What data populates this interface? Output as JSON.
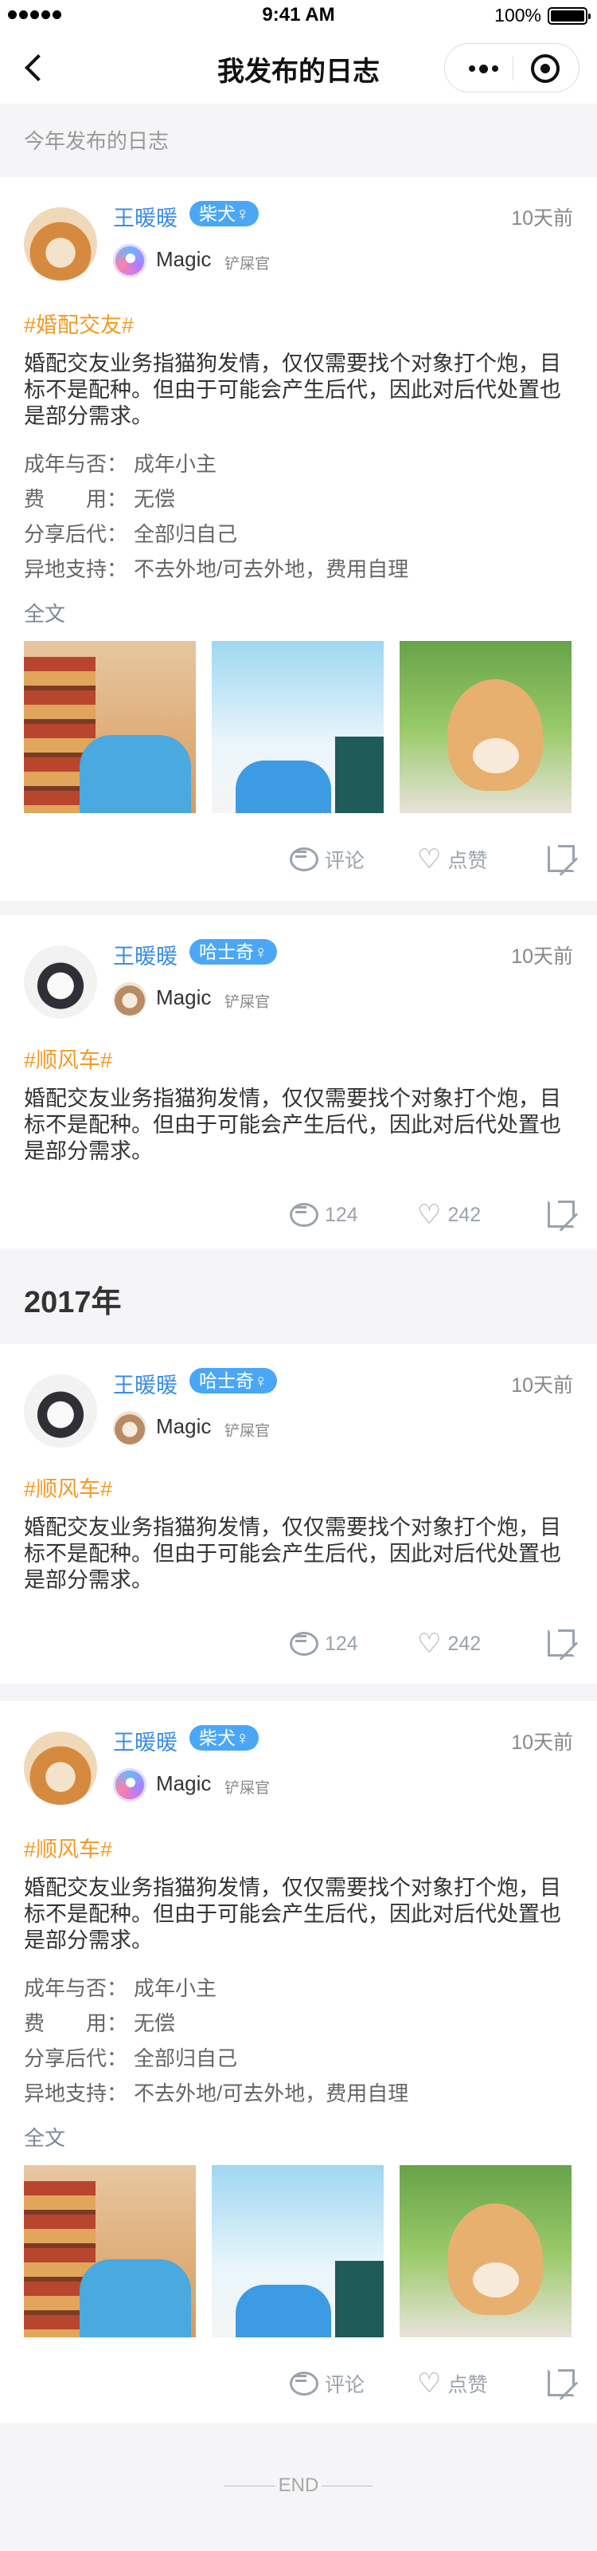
{
  "status_bar": {
    "time": "9:41 AM",
    "battery": "100%"
  },
  "nav": {
    "title": "我发布的日志"
  },
  "sections": {
    "this_year": "今年发布的日志",
    "year_2017": "2017年"
  },
  "posts": [
    {
      "user": "王暖暖",
      "breed": "柴犬♀",
      "time": "10天前",
      "pet_name": "Magic",
      "pet_role": "铲屎官",
      "tag": "#婚配交友#",
      "body": "婚配交友业务指猫狗发情，仅仅需要找个对象打个炮，目标不是配种。但由于可能会产生后代，因此对后代处置也是部分需求。",
      "info": [
        {
          "key": "成年与否：",
          "value": "成年小主"
        },
        {
          "key": "费　　用：",
          "value": "无偿"
        },
        {
          "key": "分享后代：",
          "value": "全部归自己"
        },
        {
          "key": "异地支持：",
          "value": "不去外地/可去外地，费用自理"
        }
      ],
      "full_text": "全文",
      "comment": "评论",
      "like": "点赞"
    },
    {
      "user": "王暖暖",
      "breed": "哈士奇♀",
      "time": "10天前",
      "pet_name": "Magic",
      "pet_role": "铲屎官",
      "tag": "#顺风车#",
      "body": "婚配交友业务指猫狗发情，仅仅需要找个对象打个炮，目标不是配种。但由于可能会产生后代，因此对后代处置也是部分需求。",
      "comment": "124",
      "like": "242"
    },
    {
      "user": "王暖暖",
      "breed": "哈士奇♀",
      "time": "10天前",
      "pet_name": "Magic",
      "pet_role": "铲屎官",
      "tag": "#顺风车#",
      "body": "婚配交友业务指猫狗发情，仅仅需要找个对象打个炮，目标不是配种。但由于可能会产生后代，因此对后代处置也是部分需求。",
      "comment": "124",
      "like": "242"
    },
    {
      "user": "王暖暖",
      "breed": "柴犬♀",
      "time": "10天前",
      "pet_name": "Magic",
      "pet_role": "铲屎官",
      "tag": "#顺风车#",
      "body": "婚配交友业务指猫狗发情，仅仅需要找个对象打个炮，目标不是配种。但由于可能会产生后代，因此对后代处置也是部分需求。",
      "info": [
        {
          "key": "成年与否：",
          "value": "成年小主"
        },
        {
          "key": "费　　用：",
          "value": "无偿"
        },
        {
          "key": "分享后代：",
          "value": "全部归自己"
        },
        {
          "key": "异地支持：",
          "value": "不去外地/可去外地，费用自理"
        }
      ],
      "full_text": "全文",
      "comment": "评论",
      "like": "点赞"
    }
  ],
  "end_text": "END"
}
